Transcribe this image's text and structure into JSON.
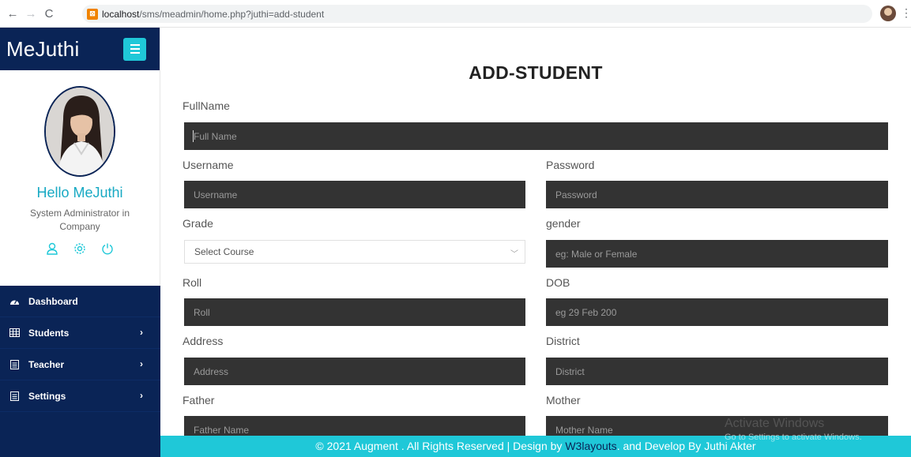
{
  "browser": {
    "url_host": "localhost",
    "url_path": "/sms/meadmin/home.php?juthi=add-student"
  },
  "sidebar": {
    "logo": "MeJuthi",
    "greeting": "Hello MeJuthi",
    "role": "System Administrator in Company",
    "nav": [
      {
        "label": "Dashboard",
        "icon": "dashboard-icon"
      },
      {
        "label": "Students",
        "icon": "table-icon"
      },
      {
        "label": "Teacher",
        "icon": "document-icon"
      },
      {
        "label": "Settings",
        "icon": "document-icon"
      }
    ]
  },
  "form": {
    "title": "ADD-STUDENT",
    "fullname_label": "FullName",
    "fullname_placeholder": "Full Name",
    "username_label": "Username",
    "username_placeholder": "Username",
    "password_label": "Password",
    "password_placeholder": "Password",
    "grade_label": "Grade",
    "grade_selected": "Select Course",
    "gender_label": "gender",
    "gender_placeholder": "eg: Male or Female",
    "roll_label": "Roll",
    "roll_placeholder": "Roll",
    "dob_label": "DOB",
    "dob_placeholder": "eg 29 Feb 200",
    "address_label": "Address",
    "address_placeholder": "Address",
    "district_label": "District",
    "district_placeholder": "District",
    "father_label": "Father",
    "father_placeholder": "Father Name",
    "mother_label": "Mother",
    "mother_placeholder": "Mother Name"
  },
  "footer": {
    "text_before": "© 2021 Augment . All Rights Reserved | Design by ",
    "link": "W3layouts",
    "text_after": ". and Develop By Juthi Akter"
  },
  "watermark": {
    "line1": "Activate Windows",
    "line2": "Go to Settings to activate Windows."
  },
  "colors": {
    "navy": "#0a2456",
    "accent": "#1fc8d8",
    "field": "#333333"
  }
}
